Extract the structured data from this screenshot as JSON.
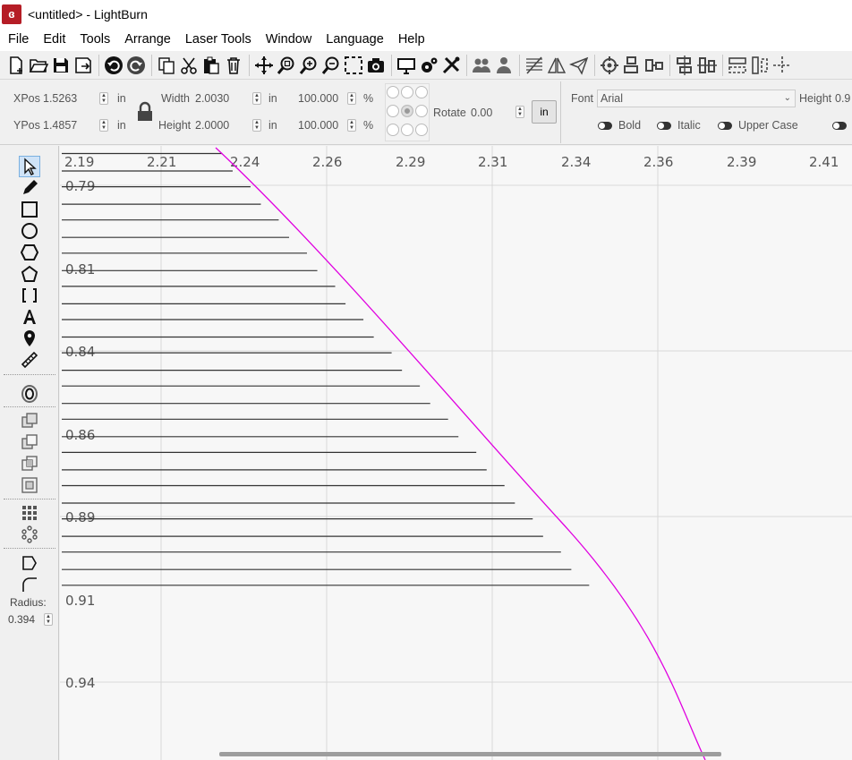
{
  "window": {
    "title": "<untitled> - LightBurn",
    "app_icon": "lightburn-logo-icon"
  },
  "menu": [
    "File",
    "Edit",
    "Tools",
    "Arrange",
    "Laser Tools",
    "Window",
    "Language",
    "Help"
  ],
  "toolbar": {
    "icons": [
      "new-file-icon",
      "open-file-icon",
      "save-icon",
      "save-as-icon",
      "import-icon",
      "undo-icon",
      "redo-icon",
      "copy-icon",
      "cut-icon",
      "paste-icon",
      "delete-icon",
      "move-icon",
      "zoom-icon",
      "zoom-in-icon",
      "zoom-out-icon",
      "frame-selection-icon",
      "camera-icon",
      "monitor-icon",
      "settings-icon",
      "tools-icon",
      "group-icon",
      "ungroup-icon",
      "mirror-h-icon",
      "mirror-v-icon",
      "paper-plane-icon",
      "target-icon",
      "align-top-icon",
      "align-center-icon",
      "align-h-icon",
      "align-v-icon",
      "distribute-h-icon",
      "distribute-v-icon",
      "nudge-icon"
    ]
  },
  "properties": {
    "xpos_label": "XPos",
    "xpos_value": "1.5263",
    "xpos_unit": "in",
    "ypos_label": "YPos",
    "ypos_value": "1.4857",
    "ypos_unit": "in",
    "width_label": "Width",
    "width_value": "2.0030",
    "width_unit": "in",
    "height_label": "Height",
    "height_value": "2.0000",
    "height_unit": "in",
    "width_pct": "100.000",
    "height_pct": "100.000",
    "pct_sign": "%",
    "rotate_label": "Rotate",
    "rotate_value": "0.00",
    "unit_button": "in",
    "font_label": "Font",
    "font_value": "Arial",
    "text_height_label": "Height",
    "text_height_value": "0.9",
    "bold_label": "Bold",
    "italic_label": "Italic",
    "uppercase_label": "Upper Case"
  },
  "left_tools": {
    "icons": [
      "select-icon",
      "pencil-icon",
      "rectangle-icon",
      "ellipse-icon",
      "polygon-icon",
      "pentagon-icon",
      "bracket-icon",
      "text-icon",
      "position-icon",
      "measure-icon",
      "offset-icon",
      "weld-icon",
      "subtract-icon",
      "intersect-icon",
      "inner-icon",
      "grid-array-icon",
      "circular-array-icon",
      "node-edit-icon",
      "corner-icon"
    ],
    "radius_label": "Radius:",
    "radius_value": "0.394"
  },
  "canvas": {
    "x_ruler": [
      "2.19",
      "2.21",
      "2.24",
      "2.26",
      "2.29",
      "2.31",
      "2.34",
      "2.36",
      "2.39",
      "2.41"
    ],
    "y_ruler": [
      "0.79",
      "0.81",
      "0.84",
      "0.86",
      "0.89",
      "0.91",
      "0.94"
    ],
    "line_color": "#333333",
    "boundary_color": "#e000e0"
  }
}
